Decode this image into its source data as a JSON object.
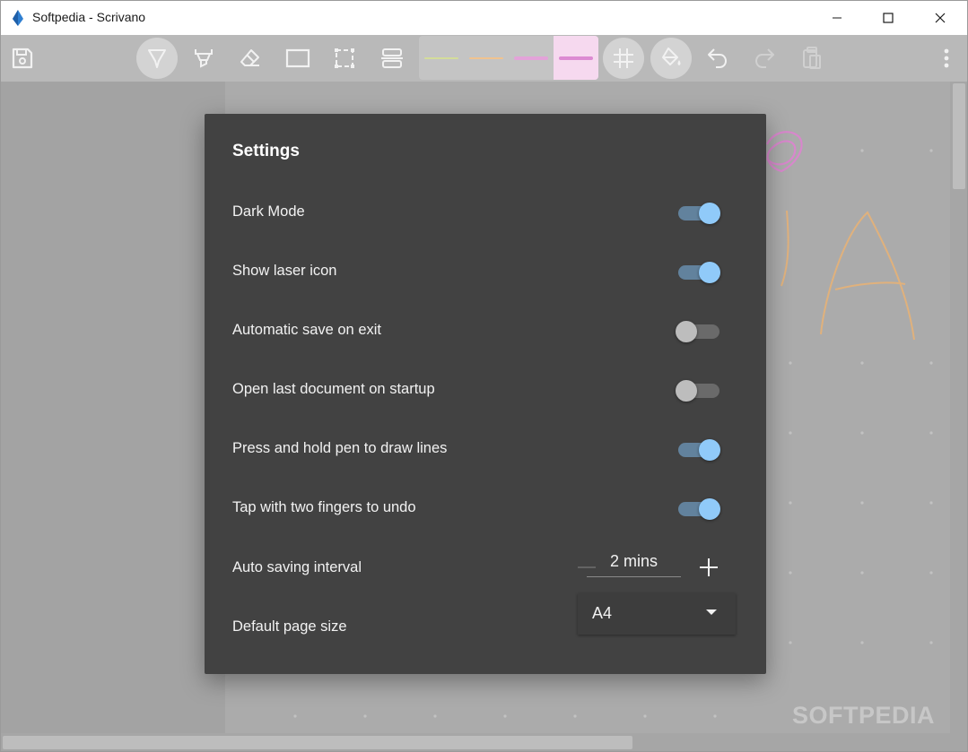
{
  "window": {
    "title": "Softpedia - Scrivano"
  },
  "toolbar": {
    "tools": [
      {
        "name": "save-icon"
      },
      {
        "name": "pen-icon",
        "active": true
      },
      {
        "name": "highlighter-icon"
      },
      {
        "name": "eraser-icon"
      },
      {
        "name": "rectangle-icon"
      },
      {
        "name": "selection-icon"
      },
      {
        "name": "insert-space-icon"
      }
    ],
    "colors": [
      {
        "color": "#d4dd9a",
        "selected": false
      },
      {
        "color": "#f0c38f",
        "selected": false
      },
      {
        "color": "#e3a3d9",
        "selected": false
      },
      {
        "color": "#dc8bd2",
        "selected": true
      }
    ],
    "right_tools": [
      "grid-icon",
      "fill-icon",
      "undo-icon",
      "redo-icon",
      "paste-icon",
      "more-icon"
    ]
  },
  "settings": {
    "title": "Settings",
    "toggles": [
      {
        "label": "Dark Mode",
        "on": true
      },
      {
        "label": "Show laser icon",
        "on": true
      },
      {
        "label": "Automatic save on exit",
        "on": false
      },
      {
        "label": "Open last document on startup",
        "on": false
      },
      {
        "label": "Press and hold pen to draw lines",
        "on": true
      },
      {
        "label": "Tap with two fingers to undo",
        "on": true
      }
    ],
    "auto_save": {
      "label": "Auto saving interval",
      "value": "2 mins"
    },
    "page_size": {
      "label": "Default page size",
      "value": "A4"
    }
  },
  "watermark": "SOFTPEDIA",
  "colors": {
    "accent": "#90caf9",
    "dialog_bg": "#424242",
    "toggle_on_track": "#62829d"
  }
}
